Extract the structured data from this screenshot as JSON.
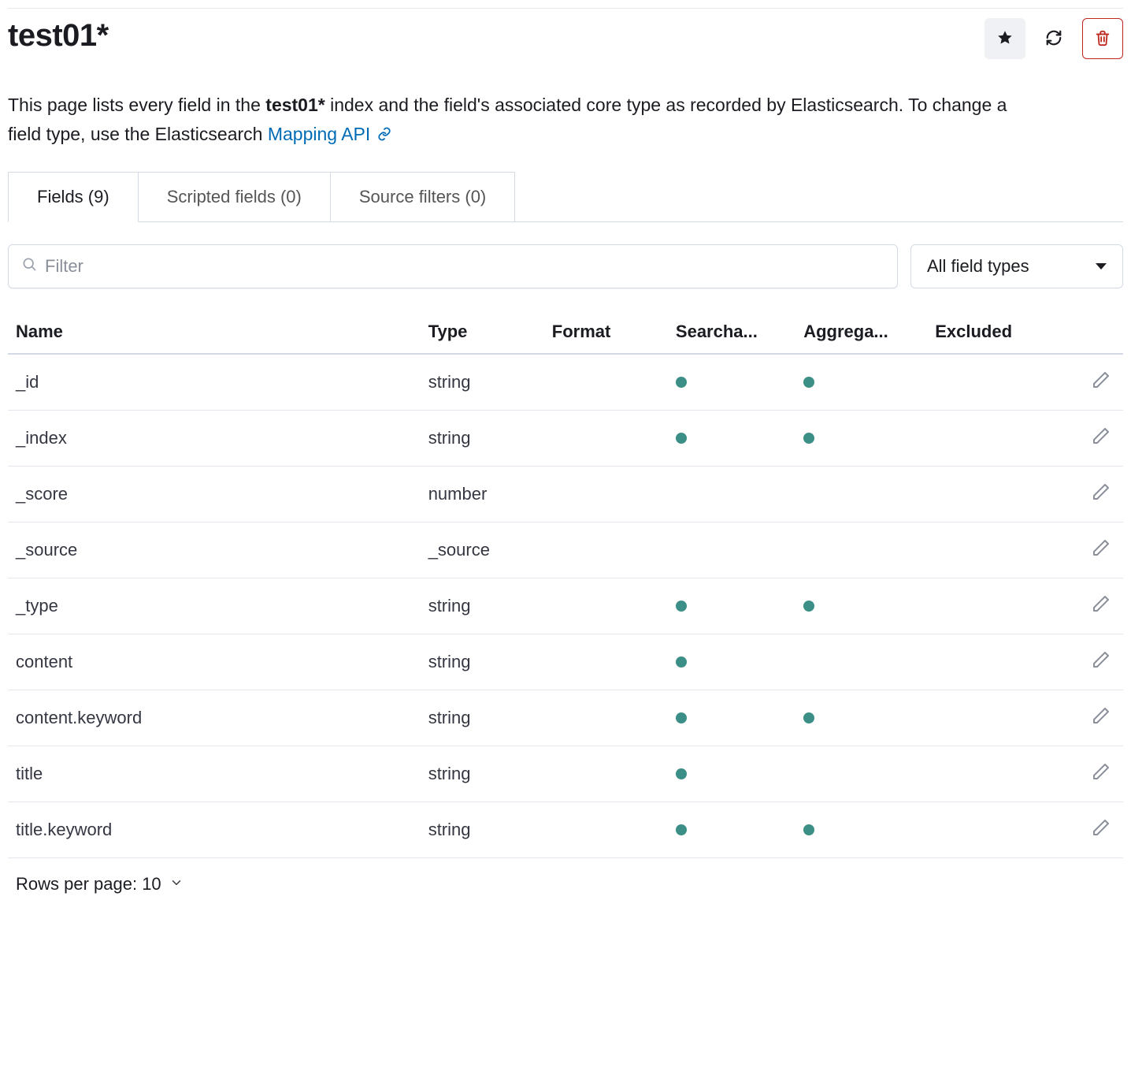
{
  "header": {
    "title": "test01*"
  },
  "description": {
    "prefix": "This page lists every field in the ",
    "index_name": "test01*",
    "mid": " index and the field's associated core type as recorded by Elasticsearch. To change a field type, use the Elasticsearch ",
    "link_text": "Mapping API"
  },
  "tabs": [
    {
      "label": "Fields (9)",
      "active": true
    },
    {
      "label": "Scripted fields (0)",
      "active": false
    },
    {
      "label": "Source filters (0)",
      "active": false
    }
  ],
  "filter": {
    "placeholder": "Filter",
    "value": ""
  },
  "type_select": {
    "label": "All field types"
  },
  "columns": {
    "name": "Name",
    "type": "Type",
    "format": "Format",
    "searchable": "Searcha...",
    "aggregatable": "Aggrega...",
    "excluded": "Excluded"
  },
  "rows": [
    {
      "name": "_id",
      "type": "string",
      "format": "",
      "searchable": true,
      "aggregatable": true,
      "excluded": false
    },
    {
      "name": "_index",
      "type": "string",
      "format": "",
      "searchable": true,
      "aggregatable": true,
      "excluded": false
    },
    {
      "name": "_score",
      "type": "number",
      "format": "",
      "searchable": false,
      "aggregatable": false,
      "excluded": false
    },
    {
      "name": "_source",
      "type": "_source",
      "format": "",
      "searchable": false,
      "aggregatable": false,
      "excluded": false
    },
    {
      "name": "_type",
      "type": "string",
      "format": "",
      "searchable": true,
      "aggregatable": true,
      "excluded": false
    },
    {
      "name": "content",
      "type": "string",
      "format": "",
      "searchable": true,
      "aggregatable": false,
      "excluded": false
    },
    {
      "name": "content.keyword",
      "type": "string",
      "format": "",
      "searchable": true,
      "aggregatable": true,
      "excluded": false
    },
    {
      "name": "title",
      "type": "string",
      "format": "",
      "searchable": true,
      "aggregatable": false,
      "excluded": false
    },
    {
      "name": "title.keyword",
      "type": "string",
      "format": "",
      "searchable": true,
      "aggregatable": true,
      "excluded": false
    }
  ],
  "pager": {
    "label": "Rows per page: 10"
  },
  "colors": {
    "dot": "#3b8f86",
    "link": "#006bb4",
    "danger": "#bd271e"
  }
}
